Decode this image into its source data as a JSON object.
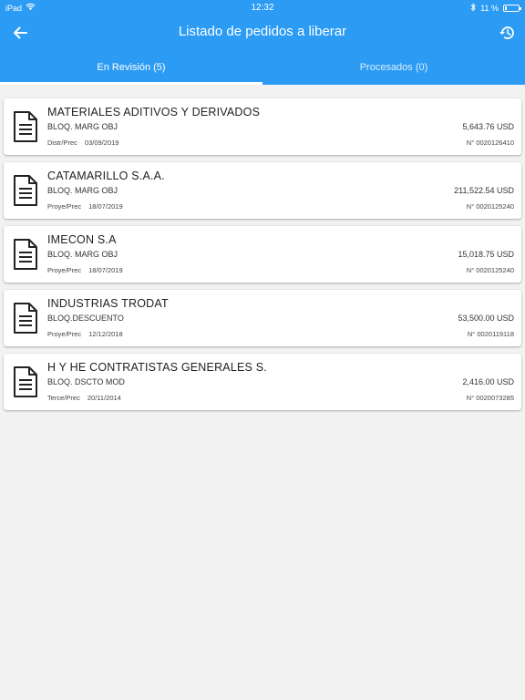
{
  "status_bar": {
    "device": "iPad",
    "time": "12:32",
    "battery": "11 %",
    "battery_level": 0.11
  },
  "header": {
    "title": "Listado de pedidos a liberar",
    "back_icon": "arrow-left-icon",
    "history_icon": "history-icon"
  },
  "tabs": [
    {
      "label": "En Revisión (5)",
      "active": true
    },
    {
      "label": "Procesados (0)",
      "active": false
    }
  ],
  "orders": [
    {
      "client": "MATERIALES ADITIVOS Y DERIVADOS",
      "status": "BLOQ. MARG OBJ",
      "amount": "5,643.76 USD",
      "type": "Distr/Prec",
      "date": "03/09/2019",
      "number": "N° 0020126410"
    },
    {
      "client": "CATAMARILLO S.A.A.",
      "status": "BLOQ. MARG OBJ",
      "amount": "211,522.54 USD",
      "type": "Proye/Prec",
      "date": "18/07/2019",
      "number": "N° 0020125240"
    },
    {
      "client": "IMECON S.A",
      "status": "BLOQ. MARG OBJ",
      "amount": "15,018.75 USD",
      "type": "Proye/Prec",
      "date": "18/07/2019",
      "number": "N° 0020125240"
    },
    {
      "client": "INDUSTRIAS TRODAT",
      "status": "BLOQ.DESCUENTO",
      "amount": "53,500.00 USD",
      "type": "Proye/Prec",
      "date": "12/12/2018",
      "number": "N° 0020119118"
    },
    {
      "client": "H Y HE CONTRATISTAS GENERALES S.",
      "status": "BLOQ. DSCTO MOD",
      "amount": "2,416.00 USD",
      "type": "Terce/Prec",
      "date": "20/11/2014",
      "number": "N° 0020073285"
    }
  ],
  "colors": {
    "primary": "#2b9bf4",
    "background": "#f2f2f2",
    "card": "#ffffff"
  }
}
